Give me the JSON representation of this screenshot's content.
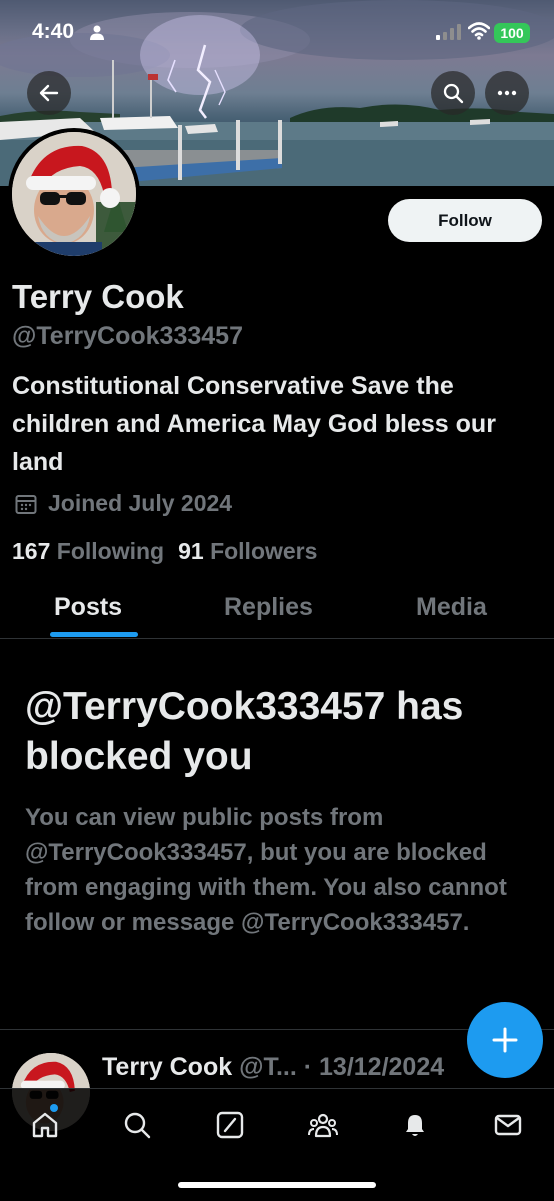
{
  "status_bar": {
    "time": "4:40",
    "battery": "100"
  },
  "profile": {
    "name": "Terry Cook",
    "handle": "@TerryCook333457",
    "bio": "Constitutional Conservative Save the children and America May God bless our land",
    "joined": "Joined July 2024",
    "following_count": "167",
    "following_label": "Following",
    "followers_count": "91",
    "followers_label": "Followers",
    "follow_button": "Follow"
  },
  "tabs": [
    {
      "label": "Posts",
      "active": true
    },
    {
      "label": "Replies",
      "active": false
    },
    {
      "label": "Media",
      "active": false
    }
  ],
  "blocked": {
    "title": "@TerryCook333457 has blocked you",
    "body": "You can view public posts from @TerryCook333457, but you are blocked from engaging with them. You also cannot follow or message @TerryCook333457."
  },
  "post_preview": {
    "name": "Terry Cook",
    "meta": "@T... · 13/12/2024"
  },
  "nav": [
    "home-icon",
    "search-icon",
    "grok-icon",
    "communities-icon",
    "notifications-icon",
    "messages-icon"
  ],
  "colors": {
    "accent": "#1d9bf0",
    "background": "#000000",
    "text_primary": "#e7e9ea",
    "text_secondary": "#71767b"
  }
}
